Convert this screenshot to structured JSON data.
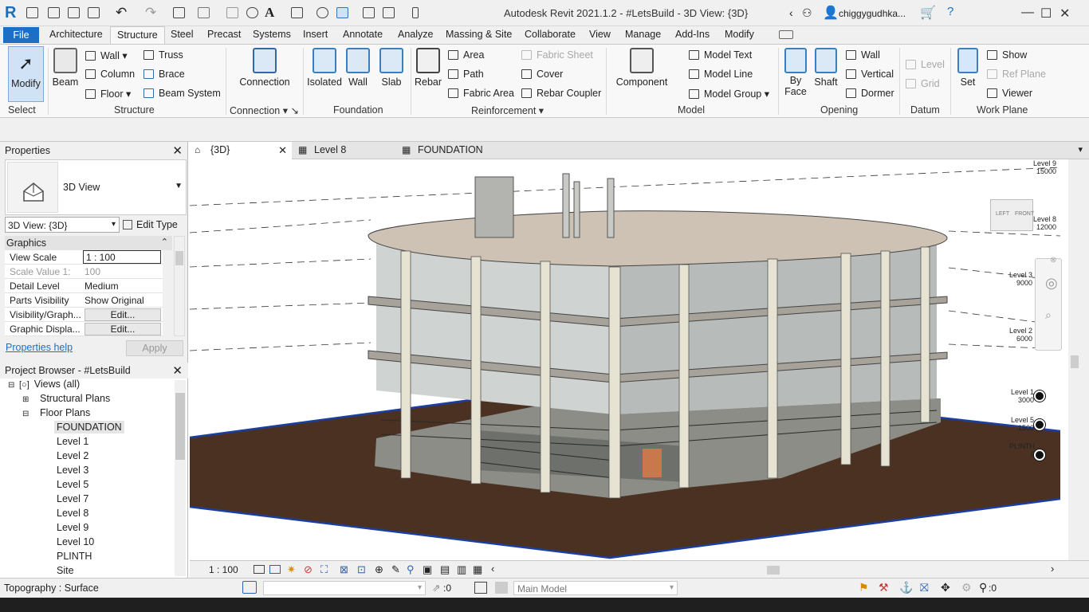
{
  "app": {
    "title": "Autodesk Revit 2021.1.2 - #LetsBuild - 3D View: {3D}",
    "user": "chiggygudhka..."
  },
  "tabs": [
    "File",
    "Architecture",
    "Structure",
    "Steel",
    "Precast",
    "Systems",
    "Insert",
    "Annotate",
    "Analyze",
    "Massing & Site",
    "Collaborate",
    "View",
    "Manage",
    "Add-Ins",
    "Modify"
  ],
  "ribbon": {
    "modify": "Modify",
    "select": "Select",
    "structure": {
      "beam": "Beam",
      "wall": "Wall",
      "column": "Column",
      "floor": "Floor",
      "truss": "Truss",
      "brace": "Brace",
      "beam_system": "Beam  System",
      "panel": "Structure"
    },
    "connection": {
      "label": "Connection",
      "panel": "Connection"
    },
    "foundation": {
      "isolated": "Isolated",
      "wall": "Wall",
      "slab": "Slab",
      "panel": "Foundation"
    },
    "reinforcement": {
      "rebar": "Rebar",
      "area": "Area",
      "path": "Path",
      "fabric_area": "Fabric  Area",
      "fabric_sheet": "Fabric  Sheet",
      "cover": "Cover",
      "rebar_coupler": "Rebar  Coupler",
      "panel": "Reinforcement"
    },
    "model": {
      "component": "Component",
      "model_text": "Model  Text",
      "model_line": "Model  Line",
      "model_group": "Model  Group",
      "panel": "Model"
    },
    "opening": {
      "by_face": "By\nFace",
      "by": "By",
      "face": "Face",
      "shaft": "Shaft",
      "wall": "Wall",
      "vertical": "Vertical",
      "dormer": "Dormer",
      "panel": "Opening"
    },
    "datum": {
      "level": "Level",
      "grid": "Grid",
      "panel": "Datum"
    },
    "workplane": {
      "set": "Set",
      "show": "Show",
      "ref_plane": "Ref  Plane",
      "viewer": "Viewer",
      "panel": "Work Plane"
    }
  },
  "properties": {
    "title": "Properties",
    "type": "3D View",
    "selector": "3D View: {3D}",
    "edit_type": "Edit Type",
    "section": "Graphics",
    "rows": [
      {
        "k": "View Scale",
        "v": "1 : 100"
      },
      {
        "k": "Scale Value    1:",
        "v": "100"
      },
      {
        "k": "Detail Level",
        "v": "Medium"
      },
      {
        "k": "Parts Visibility",
        "v": "Show Original"
      },
      {
        "k": "Visibility/Graph...",
        "v": "Edit..."
      },
      {
        "k": "Graphic Displa...",
        "v": "Edit..."
      }
    ],
    "help": "Properties help",
    "apply": "Apply"
  },
  "browser": {
    "title": "Project Browser - #LetsBuild",
    "views_all": "Views (all)",
    "structural_plans": "Structural Plans",
    "floor_plans": "Floor Plans",
    "items": [
      "FOUNDATION",
      "Level 1",
      "Level 2",
      "Level 3",
      "Level 5",
      "Level 7",
      "Level 8",
      "Level 9",
      "Level 10",
      "PLINTH",
      "Site"
    ]
  },
  "view_tabs": [
    "{3D}",
    "Level 8",
    "FOUNDATION"
  ],
  "levels": [
    {
      "name": "Level 9",
      "elev": "15000"
    },
    {
      "name": "Level 8",
      "elev": "12000"
    },
    {
      "name": "Level 3",
      "elev": "9000"
    },
    {
      "name": "Level 2",
      "elev": "6000"
    },
    {
      "name": "Level 1",
      "elev": "3000"
    },
    {
      "name": "Level 5",
      "elev": "1500"
    },
    {
      "name": "PLINTH",
      "elev": "0"
    }
  ],
  "viewcube": {
    "left": "LEFT",
    "front": "FRONT"
  },
  "view_scale": "1 : 100",
  "status": {
    "selection": "Topography : Surface",
    "count": ":0",
    "model": "Main Model",
    "filter": ":0"
  }
}
